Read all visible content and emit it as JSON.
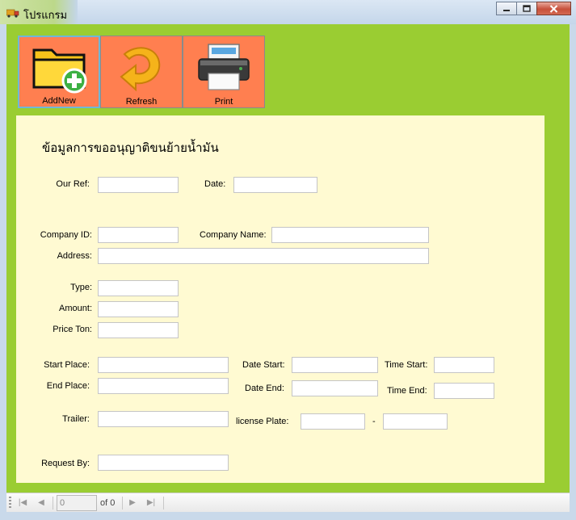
{
  "window": {
    "title": "โปรแกรม",
    "app_icon": "truck-icon",
    "controls": [
      "minimize-icon",
      "maximize-icon",
      "close-icon"
    ]
  },
  "toolbar": {
    "buttons": [
      {
        "label": "AddNew",
        "icon": "folder-add-icon"
      },
      {
        "label": "Refresh",
        "icon": "refresh-arrow-icon"
      },
      {
        "label": "Print",
        "icon": "printer-icon"
      }
    ]
  },
  "form": {
    "title": "ข้อมูลการขออนุญาติขนย้ายน้ำมัน",
    "fields": {
      "our_ref": {
        "label": "Our Ref:",
        "value": ""
      },
      "date": {
        "label": "Date:",
        "value": ""
      },
      "company_id": {
        "label": "Company ID:",
        "value": ""
      },
      "company_name": {
        "label": "Company Name:",
        "value": ""
      },
      "address": {
        "label": "Address:",
        "value": ""
      },
      "type": {
        "label": "Type:",
        "value": ""
      },
      "amount": {
        "label": "Amount:",
        "value": ""
      },
      "price_ton": {
        "label": "Price Ton:",
        "value": ""
      },
      "start_place": {
        "label": "Start Place:",
        "value": ""
      },
      "date_start": {
        "label": "Date Start:",
        "value": ""
      },
      "time_start": {
        "label": "Time Start:",
        "value": ""
      },
      "end_place": {
        "label": "End Place:",
        "value": ""
      },
      "date_end": {
        "label": "Date End:",
        "value": ""
      },
      "time_end": {
        "label": "Time End:",
        "value": ""
      },
      "trailer": {
        "label": "Trailer:",
        "value": ""
      },
      "license_plate": {
        "label": "license Plate:",
        "value": "",
        "value2": "",
        "separator": "-"
      },
      "request_by": {
        "label": "Request By:",
        "value": ""
      }
    }
  },
  "navigator": {
    "position": "0",
    "count_text": "of 0"
  },
  "colors": {
    "client_bg": "#9acd32",
    "panel_bg": "#fffad2",
    "toolbar_btn_bg": "#ff7f50"
  }
}
